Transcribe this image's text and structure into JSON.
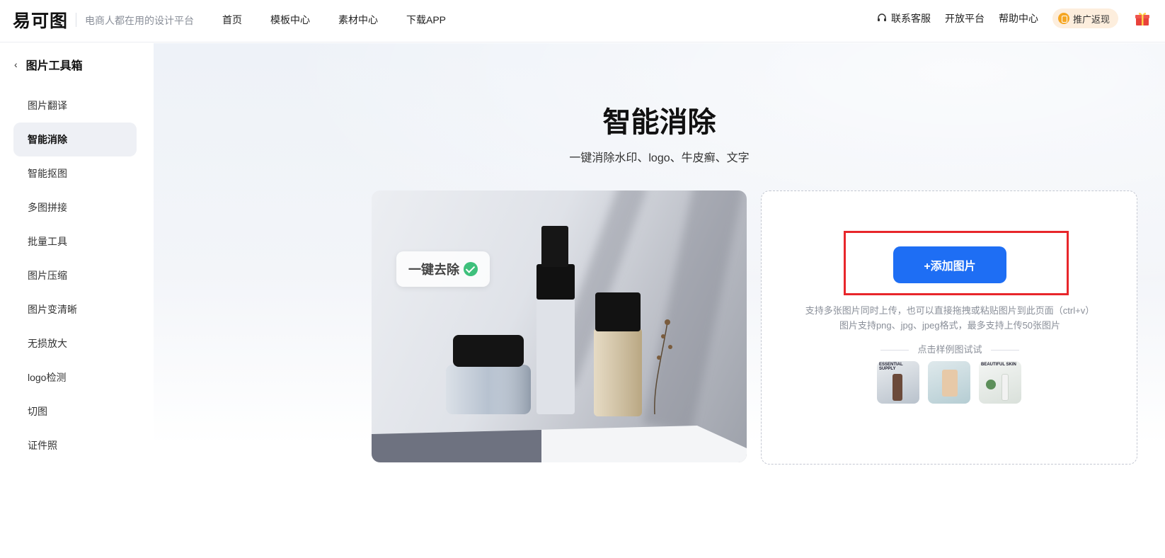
{
  "header": {
    "logo_text": "易可图",
    "slogan": "电商人都在用的设计平台",
    "nav": [
      "首页",
      "模板中心",
      "素材中心",
      "下载APP"
    ],
    "right_nav": {
      "service": "联系客服",
      "open_platform": "开放平台",
      "help": "帮助中心",
      "promo": "推广返现"
    }
  },
  "sidebar": {
    "title": "图片工具箱",
    "items": [
      {
        "label": "图片翻译",
        "active": false
      },
      {
        "label": "智能消除",
        "active": true
      },
      {
        "label": "智能抠图",
        "active": false
      },
      {
        "label": "多图拼接",
        "active": false
      },
      {
        "label": "批量工具",
        "active": false
      },
      {
        "label": "图片压缩",
        "active": false
      },
      {
        "label": "图片变清晰",
        "active": false
      },
      {
        "label": "无损放大",
        "active": false
      },
      {
        "label": "logo检测",
        "active": false
      },
      {
        "label": "切图",
        "active": false
      },
      {
        "label": "证件照",
        "active": false
      }
    ]
  },
  "hero": {
    "title": "智能消除",
    "subtitle": "一键消除水印、logo、牛皮癣、文字"
  },
  "demo": {
    "badge": "一键去除"
  },
  "upload": {
    "button": "+添加图片",
    "hint1": "支持多张图片同时上传，也可以直接拖拽或粘贴图片到此页面（ctrl+v）",
    "hint2": "图片支持png、jpg、jpeg格式，最多支持上传50张图片",
    "sample_label": "点击样例图试试",
    "samples": [
      {
        "tag": "ESSENTIAL SUPPLY"
      },
      {
        "tag": ""
      },
      {
        "tag": "BEAUTIFUL SKIN"
      }
    ]
  },
  "colors": {
    "accent": "#1e6ef4",
    "highlight_box": "#e8262b",
    "active_bg": "#eef0f5"
  }
}
